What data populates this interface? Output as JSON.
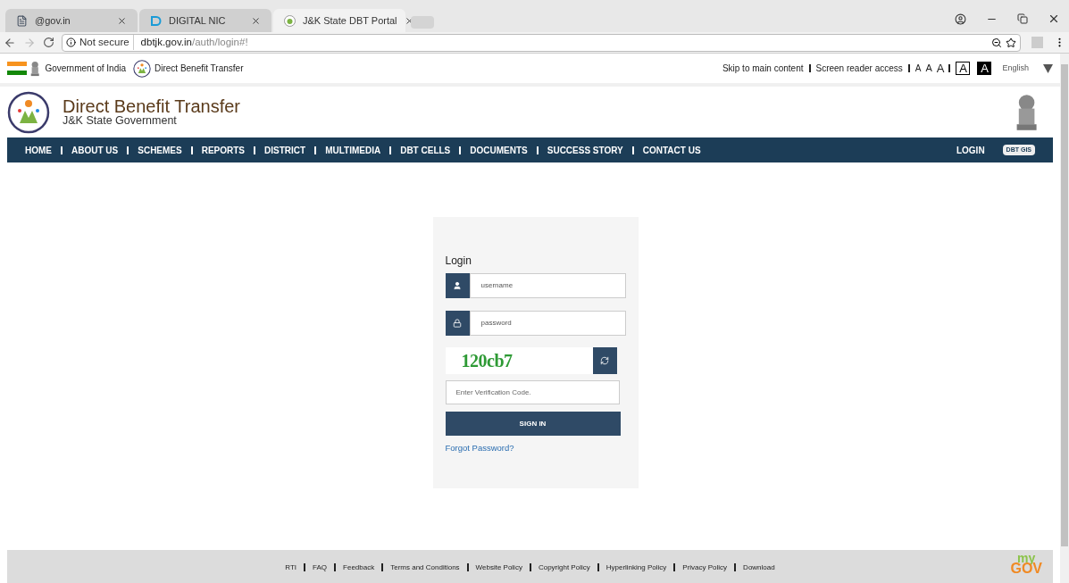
{
  "browser": {
    "tabs": [
      {
        "title": "@gov.in",
        "selected": false,
        "kind": "page"
      },
      {
        "title": "DIGITAL NIC",
        "selected": false,
        "kind": "nic"
      },
      {
        "title": "J&K State DBT Portal",
        "selected": true,
        "kind": "dbt"
      }
    ],
    "security": "Not secure",
    "url_host": "dbtjk.gov.in",
    "url_path": "/auth/login#!"
  },
  "gov_bar": {
    "government": "Government of India",
    "dbt": "Direct Benefit Transfer",
    "links": [
      "Skip to main content",
      "Screen reader access"
    ],
    "font_sizes": [
      "A",
      "A",
      "A"
    ],
    "contrast": [
      {
        "label": "A",
        "selected": false
      },
      {
        "label": "A",
        "selected": true
      }
    ],
    "language": "English"
  },
  "header": {
    "title": "Direct Benefit Transfer",
    "subtitle": "J&K State Government"
  },
  "nav": {
    "items": [
      "HOME",
      "ABOUT US",
      "SCHEMES",
      "REPORTS",
      "DISTRICT",
      "MULTIMEDIA",
      "DBT CELLS",
      "DOCUMENTS",
      "SUCCESS STORY",
      "CONTACT US"
    ],
    "login": "LOGIN",
    "gis": "DBT GIS"
  },
  "login": {
    "title": "Login",
    "username_placeholder": "username",
    "password_placeholder": "password",
    "captcha": "120cb7",
    "code_placeholder": "Enter Verification Code.",
    "sign_in": "SIGN IN",
    "forgot": "Forgot Password?"
  },
  "footer": {
    "links": [
      "RTI",
      "FAQ",
      "Feedback",
      "Terms and Conditions",
      "Website Policy",
      "Copyright Policy",
      "Hyperlinking Policy",
      "Privacy Policy",
      "Download"
    ],
    "logo_top": "my",
    "logo_bottom": "GOV"
  }
}
